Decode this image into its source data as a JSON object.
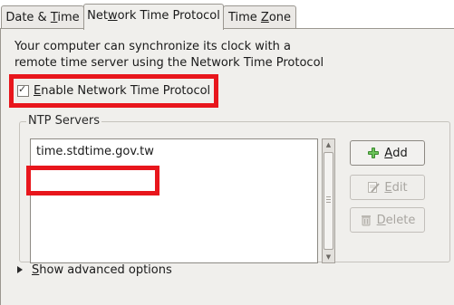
{
  "tabs": [
    {
      "label_pre": "Date & ",
      "mnemonic": "T",
      "label_post": "ime",
      "active": false
    },
    {
      "label_pre": "Net",
      "mnemonic": "w",
      "label_post": "ork Time Protocol",
      "active": true
    },
    {
      "label_pre": "Time ",
      "mnemonic": "Z",
      "label_post": "one",
      "active": false
    }
  ],
  "description": {
    "line1": "Your computer can synchronize its clock with a",
    "line2": "remote time server using the Network Time Protocol"
  },
  "ntp_toggle": {
    "label_pre": "",
    "mnemonic": "E",
    "label_post": "nable Network Time Protocol",
    "checked": true
  },
  "ntp_servers": {
    "label": "NTP Servers",
    "items": [
      "time.stdtime.gov.tw"
    ]
  },
  "buttons": {
    "add": {
      "mnemonic": "A",
      "label_post": "dd",
      "icon": "plus-icon",
      "enabled": true
    },
    "edit": {
      "mnemonic": "E",
      "label_post": "dit",
      "icon": "edit-icon",
      "enabled": false
    },
    "delete": {
      "mnemonic": "D",
      "label_post": "elete",
      "icon": "trash-icon",
      "enabled": false
    }
  },
  "advanced": {
    "mnemonic": "S",
    "label_post": "how advanced options"
  },
  "colors": {
    "highlight_box": "#e8161c",
    "panel_bg": "#f0efec",
    "add_icon": "#3b8a2f"
  }
}
